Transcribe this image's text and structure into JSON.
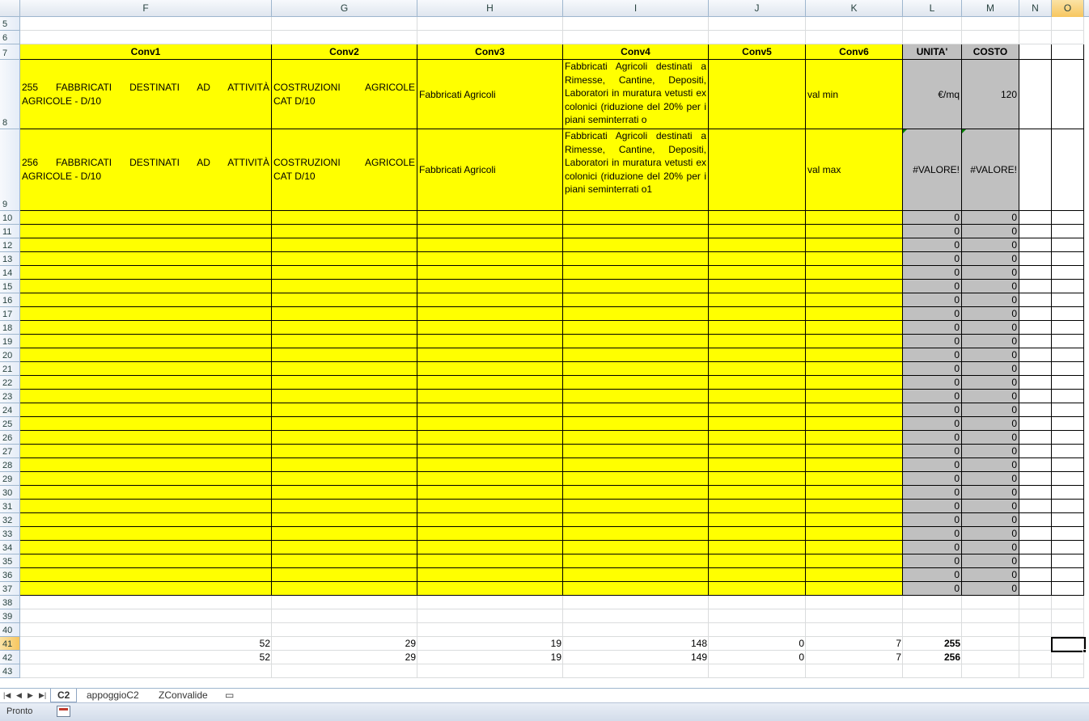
{
  "columns": [
    "F",
    "G",
    "H",
    "I",
    "J",
    "K",
    "L",
    "M",
    "N",
    "O"
  ],
  "selected_column": "O",
  "selected_row": "41",
  "row_numbers": [
    "5",
    "6",
    "7",
    "8",
    "9",
    "10",
    "11",
    "12",
    "13",
    "14",
    "15",
    "16",
    "17",
    "18",
    "19",
    "20",
    "21",
    "22",
    "23",
    "24",
    "25",
    "26",
    "27",
    "28",
    "29",
    "30",
    "31",
    "32",
    "33",
    "34",
    "35",
    "36",
    "37",
    "38",
    "39",
    "40",
    "41",
    "42",
    "43"
  ],
  "headers": {
    "F": "Conv1",
    "G": "Conv2",
    "H": "Conv3",
    "I": "Conv4",
    "J": "Conv5",
    "K": "Conv6",
    "L": "UNITA'",
    "M": "COSTO"
  },
  "row8": {
    "F_line1": "255 FABBRICATI DESTINATI AD ATTIVITÀ",
    "F_line2": "AGRICOLE - D/10",
    "G_line1": "COSTRUZIONI AGRICOLE",
    "G_line2": "CAT D/10",
    "H": "Fabbricati Agricoli",
    "I": "Fabbricati Agricoli destinati a Rimesse, Cantine, Depositi, Laboratori in muratura vetusti ex colonici (riduzione del 20% per i piani seminterrati o",
    "J": "",
    "K": "val min",
    "L": "€/mq",
    "M": "120"
  },
  "row9": {
    "F_line1": "256 FABBRICATI DESTINATI AD ATTIVITÀ",
    "F_line2": "AGRICOLE - D/10",
    "G_line1": "COSTRUZIONI AGRICOLE",
    "G_line2": "CAT D/10",
    "H": "Fabbricati Agricoli",
    "I": "Fabbricati Agricoli destinati a Rimesse, Cantine, Depositi, Laboratori in muratura vetusti ex colonici (riduzione del 20% per i piani seminterrati o1",
    "J": "",
    "K": "val max",
    "L": "#VALORE!",
    "M": "#VALORE!"
  },
  "zero_rows_value": "0",
  "row41": {
    "F": "52",
    "G": "29",
    "H": "19",
    "I": "148",
    "J": "0",
    "K": "7",
    "L": "255"
  },
  "row42": {
    "F": "52",
    "G": "29",
    "H": "19",
    "I": "149",
    "J": "0",
    "K": "7",
    "L": "256"
  },
  "sheet_tabs": [
    "C2",
    "appoggioC2",
    "ZConvalide"
  ],
  "active_tab": "C2",
  "status_text": "Pronto"
}
